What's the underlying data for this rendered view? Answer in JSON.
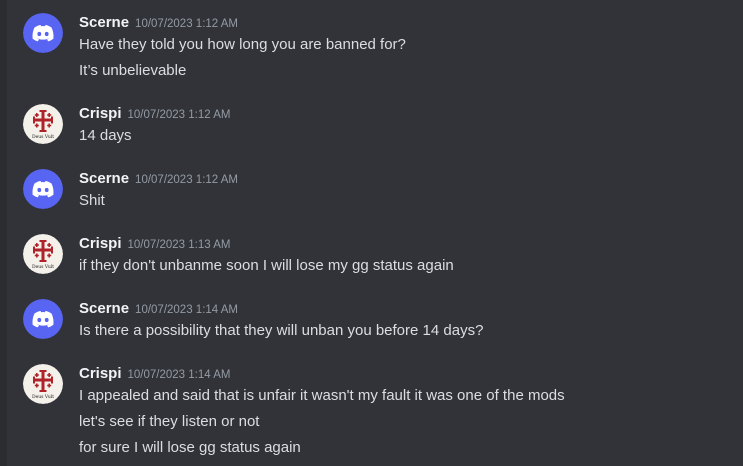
{
  "colors": {
    "background": "#313338",
    "username": "#f2f3f5",
    "text": "#dbdee1",
    "timestamp": "#949ba4",
    "discord_avatar_bg": "#5865f2"
  },
  "messages": [
    {
      "author": "Scerne",
      "avatar": "discord-logo-icon",
      "timestamp": "10/07/2023 1:12 AM",
      "lines": [
        "Have they told you how long you are banned for?",
        "It’s unbelievable"
      ]
    },
    {
      "author": "Crispi",
      "avatar": "deus-vult-emblem",
      "avatar_caption": "Deus Vult",
      "timestamp": "10/07/2023 1:12 AM",
      "lines": [
        "14 days"
      ]
    },
    {
      "author": "Scerne",
      "avatar": "discord-logo-icon",
      "timestamp": "10/07/2023 1:12 AM",
      "lines": [
        "Shit"
      ]
    },
    {
      "author": "Crispi",
      "avatar": "deus-vult-emblem",
      "avatar_caption": "Deus Vult",
      "timestamp": "10/07/2023 1:13 AM",
      "lines": [
        "if they don't unbanme soon I will lose my gg status again"
      ]
    },
    {
      "author": "Scerne",
      "avatar": "discord-logo-icon",
      "timestamp": "10/07/2023 1:14 AM",
      "lines": [
        "Is there a possibility that they will unban you before 14 days?"
      ]
    },
    {
      "author": "Crispi",
      "avatar": "deus-vult-emblem",
      "avatar_caption": "Deus Vult",
      "timestamp": "10/07/2023 1:14 AM",
      "lines": [
        "I appealed and said that is unfair it wasn't my fault it was one of the mods",
        "let's see if they listen or not",
        "for sure I will lose gg status again"
      ]
    }
  ]
}
